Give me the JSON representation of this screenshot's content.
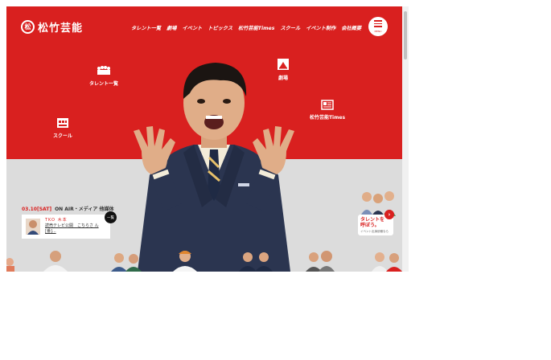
{
  "brand": {
    "name": "松竹芸能",
    "mark": "松"
  },
  "nav": [
    "タレント一覧",
    "劇場",
    "イベント",
    "トピックス",
    "松竹芸能Times",
    "スクール",
    "イベント制作",
    "会社概要"
  ],
  "menu": {
    "label": "MENU"
  },
  "quick_links": [
    {
      "label": "タレント一覧",
      "icon": "talent-group-icon"
    },
    {
      "label": "劇場",
      "icon": "theater-icon"
    },
    {
      "label": "スクール",
      "icon": "school-icon"
    },
    {
      "label": "松竹芸能Times",
      "icon": "newspaper-icon"
    }
  ],
  "news": {
    "date": "03.10[SAT]",
    "category": "ON AIR・メディア 他媒体",
    "org": "TKO 木本",
    "title": "読売テレビ公開　こちらさ ん[番]...",
    "more": "一覧"
  },
  "call_talent": {
    "title_line1": "タレントを",
    "title_line2": "呼ぼう。",
    "sub": "イベント出演依頼なら"
  },
  "colors": {
    "brand_red": "#d9201f",
    "gray_bg": "#dcdcdc"
  }
}
